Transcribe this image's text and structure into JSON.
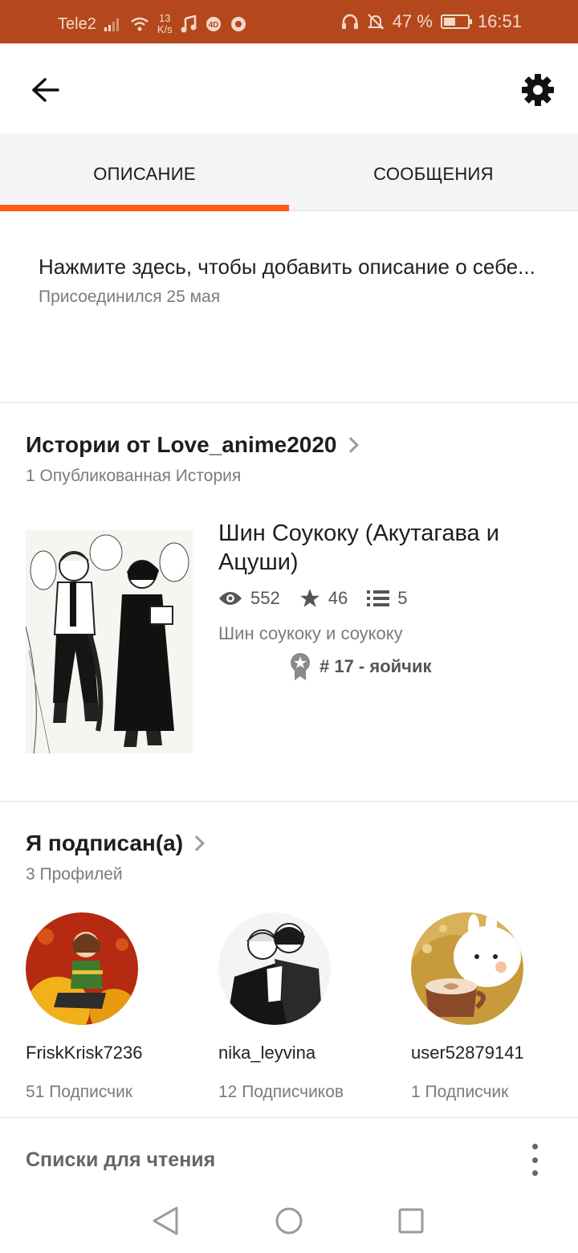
{
  "status_bar": {
    "carrier": "Tele2",
    "speed_value": "13",
    "speed_unit": "K/s",
    "battery": "47 %",
    "time": "16:51",
    "icons": [
      "signal-icon",
      "wifi-icon",
      "music-icon",
      "4d-icon",
      "chrome-icon",
      "headphones-icon",
      "bell-off-icon",
      "battery-icon"
    ]
  },
  "topbar": {
    "back_icon": "arrow-left-icon",
    "settings_icon": "gear-icon"
  },
  "tabs": [
    {
      "label": "ОПИСАНИЕ",
      "active": true
    },
    {
      "label": "СООБЩЕНИЯ",
      "active": false
    }
  ],
  "description": {
    "placeholder": "Нажмите здесь, чтобы добавить описание о себе...",
    "joined": "Присоединился 25 мая"
  },
  "stories": {
    "title": "Истории от Love_anime2020",
    "subtitle": "1 Опубликованная История",
    "items": [
      {
        "title": "Шин Соукоку (Акутагава и Ацуши)",
        "views": "552",
        "votes": "46",
        "parts": "5",
        "tags": "Шин соукоку и соукоку",
        "rank": "# 17 - яойчик"
      }
    ]
  },
  "following": {
    "title": "Я подписан(а)",
    "subtitle": "3 Профилей",
    "profiles": [
      {
        "name": "FriskKrisk7236",
        "followers": "51 Подписчик"
      },
      {
        "name": "nika_leyvina",
        "followers": "12 Подписчиков"
      },
      {
        "name": "user52879141",
        "followers": "1 Подписчик"
      }
    ]
  },
  "reading_lists": {
    "title": "Списки для чтения"
  },
  "colors": {
    "status_bar": "#b4481c",
    "accent": "#ff5a14",
    "tab_bg": "#f4f3f5"
  }
}
